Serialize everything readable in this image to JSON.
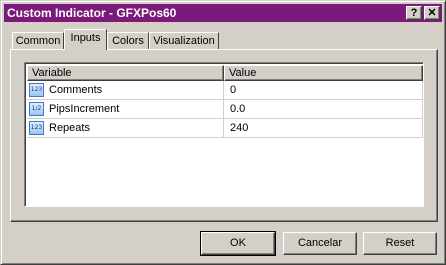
{
  "window": {
    "title": "Custom Indicator - GFXPos60"
  },
  "titlebar_buttons": {
    "help": "?",
    "close": "✕"
  },
  "tabs": [
    {
      "label": "Common"
    },
    {
      "label": "Inputs"
    },
    {
      "label": "Colors"
    },
    {
      "label": "Visualization"
    }
  ],
  "active_tab": "Inputs",
  "grid": {
    "columns": [
      "Variable",
      "Value"
    ],
    "rows": [
      {
        "icon": "123",
        "name": "Comments",
        "value": "0"
      },
      {
        "icon": "1/2",
        "name": "PipsIncrement",
        "value": "0.0"
      },
      {
        "icon": "123",
        "name": "Repeats",
        "value": "240"
      }
    ]
  },
  "buttons": {
    "ok": "OK",
    "cancel": "Cancelar",
    "reset": "Reset"
  },
  "colors": {
    "titlebar": "#7b1a7b",
    "face": "#d4d0c8"
  }
}
